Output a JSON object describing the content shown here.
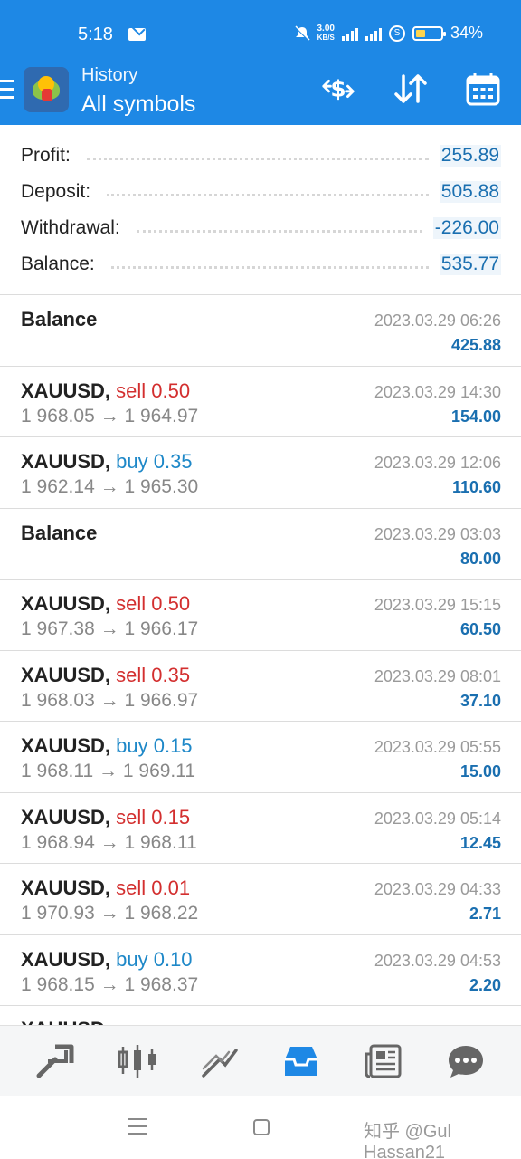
{
  "status_bar": {
    "time": "5:18",
    "net_speed_value": "3.00",
    "net_speed_unit": "KB/S",
    "battery": "34%"
  },
  "app_bar": {
    "title_small": "History",
    "title_large": "All symbols",
    "icons": [
      "menu-icon",
      "metatrader-logo",
      "currency-exchange-icon",
      "sort-icon",
      "calendar-icon"
    ]
  },
  "summary": {
    "profit": {
      "label": "Profit:",
      "value": "255.89"
    },
    "deposit": {
      "label": "Deposit:",
      "value": "505.88"
    },
    "withdrawal": {
      "label": "Withdrawal:",
      "value": "-226.00"
    },
    "balance": {
      "label": "Balance:",
      "value": "535.77"
    }
  },
  "deals": [
    {
      "kind": "balance",
      "title": "Balance",
      "time": "2023.03.29 06:26",
      "profit": "425.88"
    },
    {
      "kind": "trade",
      "symbol": "XAUUSD,",
      "side": "sell",
      "volume": "sell 0.50",
      "open": "1 968.05",
      "close": "1 964.97",
      "time": "2023.03.29 14:30",
      "profit": "154.00"
    },
    {
      "kind": "trade",
      "symbol": "XAUUSD,",
      "side": "buy",
      "volume": "buy 0.35",
      "open": "1 962.14",
      "close": "1 965.30",
      "time": "2023.03.29 12:06",
      "profit": "110.60"
    },
    {
      "kind": "balance",
      "title": "Balance",
      "time": "2023.03.29 03:03",
      "profit": "80.00"
    },
    {
      "kind": "trade",
      "symbol": "XAUUSD,",
      "side": "sell",
      "volume": "sell 0.50",
      "open": "1 967.38",
      "close": "1 966.17",
      "time": "2023.03.29 15:15",
      "profit": "60.50"
    },
    {
      "kind": "trade",
      "symbol": "XAUUSD,",
      "side": "sell",
      "volume": "sell 0.35",
      "open": "1 968.03",
      "close": "1 966.97",
      "time": "2023.03.29 08:01",
      "profit": "37.10"
    },
    {
      "kind": "trade",
      "symbol": "XAUUSD,",
      "side": "buy",
      "volume": "buy 0.15",
      "open": "1 968.11",
      "close": "1 969.11",
      "time": "2023.03.29 05:55",
      "profit": "15.00"
    },
    {
      "kind": "trade",
      "symbol": "XAUUSD,",
      "side": "sell",
      "volume": "sell 0.15",
      "open": "1 968.94",
      "close": "1 968.11",
      "time": "2023.03.29 05:14",
      "profit": "12.45"
    },
    {
      "kind": "trade",
      "symbol": "XAUUSD,",
      "side": "sell",
      "volume": "sell 0.01",
      "open": "1 970.93",
      "close": "1 968.22",
      "time": "2023.03.29 04:33",
      "profit": "2.71"
    },
    {
      "kind": "trade",
      "symbol": "XAUUSD,",
      "side": "buy",
      "volume": "buy 0.10",
      "open": "1 968.15",
      "close": "1 968.37",
      "time": "2023.03.29 04:53",
      "profit": "2.20"
    }
  ],
  "cutoff_row": {
    "symbol": "XAUUSD,"
  },
  "arrow": "→",
  "bottom_nav": [
    "quotes-icon",
    "chart-icon",
    "trade-icon",
    "history-icon",
    "news-icon",
    "chat-icon"
  ],
  "watermark": "知乎 @Gul Hassan21",
  "colors": {
    "accent": "#1e88e5",
    "sell": "#d32f2f",
    "buy": "#1e88c8",
    "profit": "#1a6fb0"
  }
}
